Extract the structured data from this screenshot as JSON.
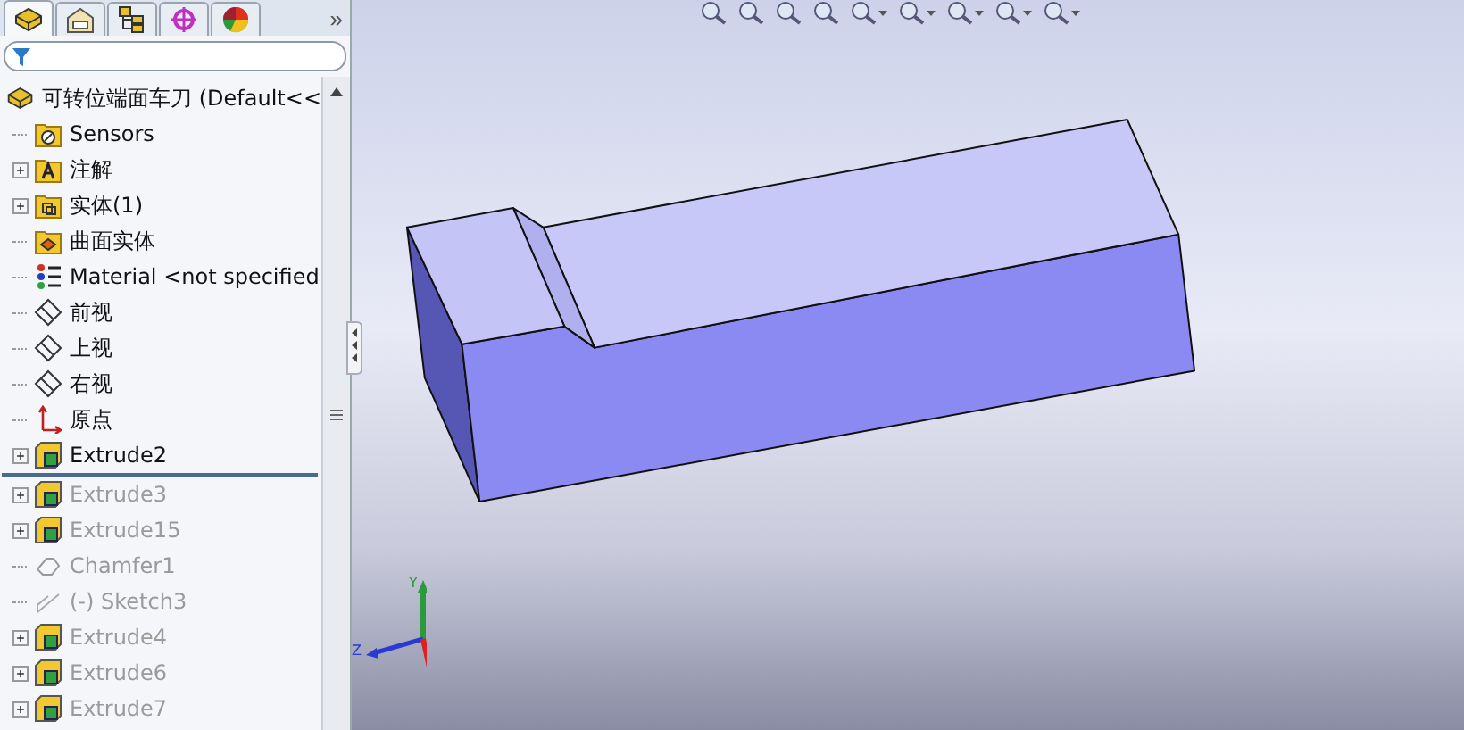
{
  "panel_tabs": [
    {
      "kind": "feature-tree",
      "selected": true
    },
    {
      "kind": "property",
      "selected": false
    },
    {
      "kind": "configuration",
      "selected": false
    },
    {
      "kind": "dimxpert",
      "selected": false
    },
    {
      "kind": "display",
      "selected": false
    }
  ],
  "more_tabs": "»",
  "tree": {
    "root": "可转位端面车刀  (Default<<",
    "items": [
      {
        "kind": "sensors",
        "label": "Sensors",
        "expandable": false,
        "suppressed": false
      },
      {
        "kind": "annotation",
        "label": "注解",
        "expandable": true,
        "suppressed": false
      },
      {
        "kind": "solid-bodies",
        "label": "实体(1)",
        "expandable": true,
        "suppressed": false
      },
      {
        "kind": "surface-bodies",
        "label": "曲面实体",
        "expandable": false,
        "suppressed": false
      },
      {
        "kind": "material",
        "label": "Material <not specified",
        "expandable": false,
        "suppressed": false
      },
      {
        "kind": "plane",
        "label": "前视",
        "expandable": false,
        "suppressed": false
      },
      {
        "kind": "plane",
        "label": "上视",
        "expandable": false,
        "suppressed": false
      },
      {
        "kind": "plane",
        "label": "右视",
        "expandable": false,
        "suppressed": false
      },
      {
        "kind": "origin",
        "label": "原点",
        "expandable": false,
        "suppressed": false
      },
      {
        "kind": "extrude",
        "label": "Extrude2",
        "expandable": true,
        "suppressed": false
      },
      {
        "kind": "rollback"
      },
      {
        "kind": "extrude",
        "label": "Extrude3",
        "expandable": true,
        "suppressed": true
      },
      {
        "kind": "extrude",
        "label": "Extrude15",
        "expandable": true,
        "suppressed": true
      },
      {
        "kind": "chamfer",
        "label": "Chamfer1",
        "expandable": false,
        "suppressed": true
      },
      {
        "kind": "sketch",
        "label": "(-) Sketch3",
        "expandable": false,
        "suppressed": true
      },
      {
        "kind": "extrude",
        "label": "Extrude4",
        "expandable": true,
        "suppressed": true
      },
      {
        "kind": "extrude",
        "label": "Extrude6",
        "expandable": true,
        "suppressed": true
      },
      {
        "kind": "extrude",
        "label": "Extrude7",
        "expandable": true,
        "suppressed": true
      }
    ]
  },
  "triad": {
    "y_label": "Y",
    "z_label": "Z"
  }
}
